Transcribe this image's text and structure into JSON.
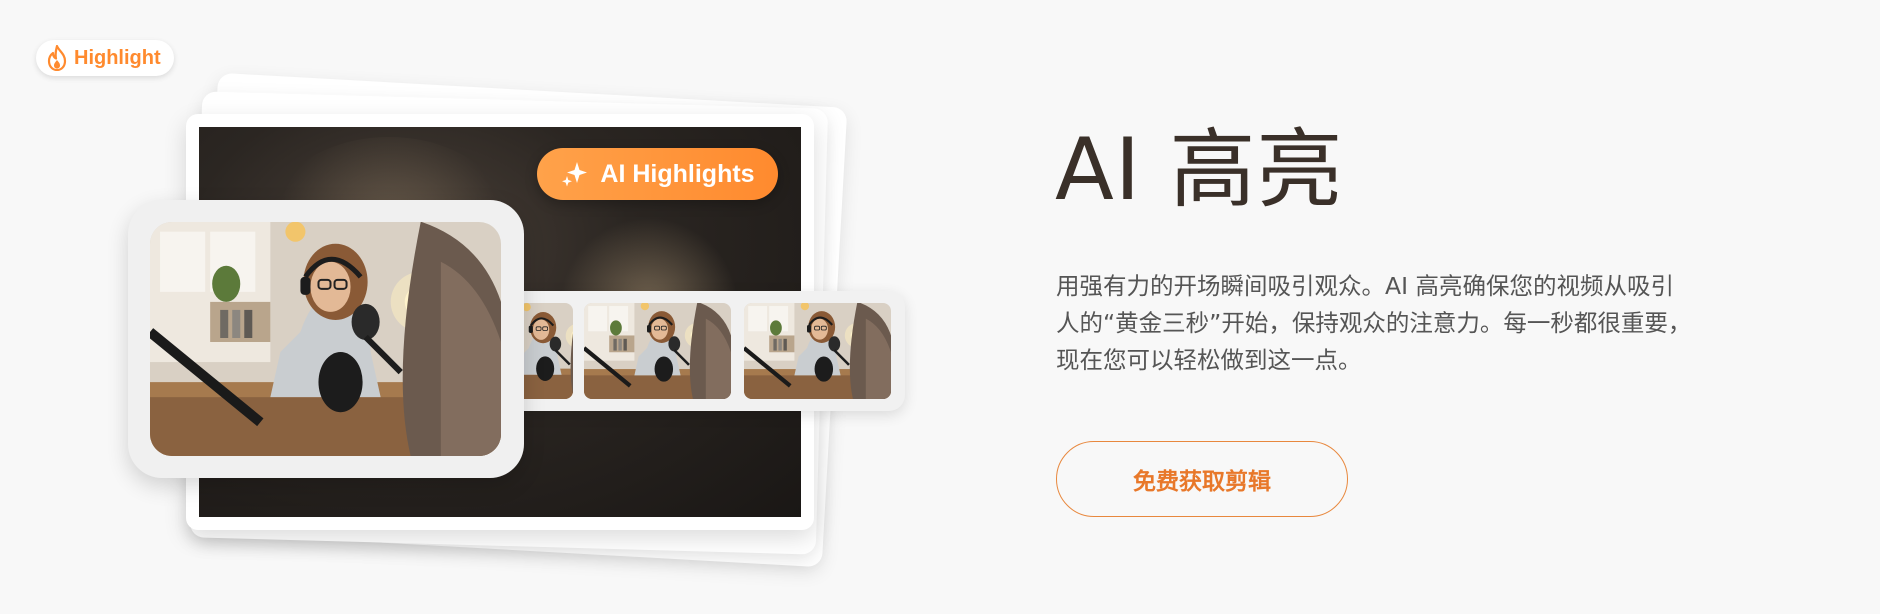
{
  "hero": {
    "title": "AI 高亮",
    "description": "用强有力的开场瞬间吸引观众。AI 高亮确保您的视频从吸引人的“黄金三秒”开始，保持观众的注意力。每一秒都很重要，现在您可以轻松做到这一点。",
    "cta_label": "免费获取剪辑"
  },
  "illustration": {
    "ai_badge_label": "AI Highlights",
    "ai_badge_icon": "sparkle-icon",
    "highlight_badge_label": "Highlight",
    "highlight_badge_icon": "flame-icon",
    "thumbnail_count": 3
  },
  "colors": {
    "accent": "#ff8a2e",
    "title_text": "#3a3029",
    "body_text": "#555555",
    "cta_border": "#e8883e",
    "background": "#f8f8f8"
  }
}
